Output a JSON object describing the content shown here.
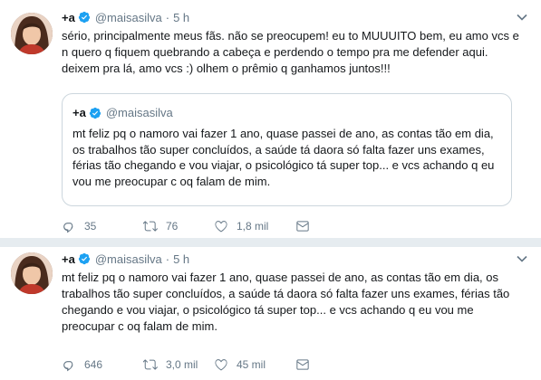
{
  "tweets": [
    {
      "author": {
        "name": "+a",
        "handle": "@maisasilva",
        "dot": "·",
        "time": "5 h"
      },
      "text": "sério, principalmente meus fãs. não se preocupem! eu to MUUUITO bem, eu amo vcs e n quero q fiquem quebrando a cabeça e perdendo o tempo pra me defender aqui. deixem pra lá, amo vcs :) olhem o prêmio q ganhamos juntos!!!",
      "quote": {
        "author": {
          "name": "+a",
          "handle": "@maisasilva"
        },
        "text": "mt feliz pq o namoro vai fazer 1 ano, quase passei de ano, as contas tão em dia, os trabalhos tão super concluídos, a saúde tá daora só falta fazer uns exames, férias tão chegando e vou viajar, o psicológico tá super top... e vcs achando q eu vou me preocupar c oq falam de mim."
      },
      "actions": {
        "replies": "35",
        "retweets": "76",
        "likes": "1,8 mil"
      }
    },
    {
      "author": {
        "name": "+a",
        "handle": "@maisasilva",
        "dot": "·",
        "time": "5 h"
      },
      "text": "mt feliz pq o namoro vai fazer 1 ano, quase passei de ano, as contas tão em dia, os trabalhos tão super concluídos, a saúde tá daora só falta fazer uns exames, férias tão chegando e vou viajar, o psicológico tá super top... e vcs achando q eu vou me preocupar c oq falam de mim.",
      "actions": {
        "replies": "646",
        "retweets": "3,0 mil",
        "likes": "45 mil"
      }
    }
  ],
  "icons": {
    "verified": "verified-badge-icon",
    "caret": "chevron-down-icon",
    "reply": "reply-icon",
    "retweet": "retweet-icon",
    "like": "heart-icon"
  },
  "colors": {
    "verified": "#1da1f2",
    "secondary_text": "#657786",
    "separator": "#e6ecf0",
    "border": "#ccd6dd"
  }
}
